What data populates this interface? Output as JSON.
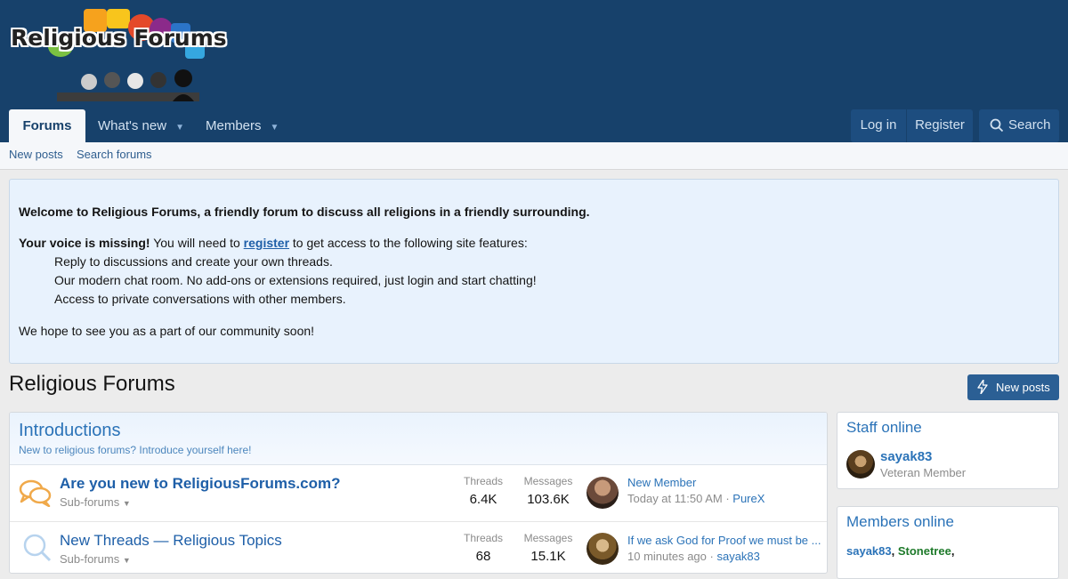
{
  "logo": {
    "text": "Religious Forums"
  },
  "nav": {
    "tabs": [
      {
        "label": "Forums"
      },
      {
        "label": "What's new"
      },
      {
        "label": "Members"
      }
    ],
    "login": "Log in",
    "register": "Register",
    "search": "Search"
  },
  "subnav": {
    "new_posts": "New posts",
    "search_forums": "Search forums"
  },
  "notice": {
    "welcome": "Welcome to Religious Forums, a friendly forum to discuss all religions in a friendly surrounding.",
    "missing_bold": "Your voice is missing!",
    "missing_pre": " You will need to ",
    "register_link": "register",
    "missing_post": " to get access to the following site features:",
    "features": [
      "Reply to discussions and create your own threads.",
      "Our modern chat room. No add-ons or extensions required, just login and start chatting!",
      "Access to private conversations with other members."
    ],
    "closing": "We hope to see you as a part of our community soon!"
  },
  "page": {
    "title": "Religious Forums",
    "new_posts_button": "New posts"
  },
  "category": {
    "title": "Introductions",
    "description": "New to religious forums? Introduce yourself here!",
    "nodes": [
      {
        "title": "Are you new to ReligiousForums.com?",
        "subforums": "Sub-forums",
        "threads_label": "Threads",
        "threads": "6.4K",
        "messages_label": "Messages",
        "messages": "103.6K",
        "latest_title": "New Member",
        "latest_time": "Today at 11:50 AM",
        "latest_sep": " · ",
        "latest_user": "PureX"
      },
      {
        "title": "New Threads — Religious Topics",
        "subforums": "Sub-forums",
        "threads_label": "Threads",
        "threads": "68",
        "messages_label": "Messages",
        "messages": "15.1K",
        "latest_title": "If we ask God for Proof we must be ...",
        "latest_time": "10 minutes ago",
        "latest_sep": " · ",
        "latest_user": "sayak83"
      }
    ]
  },
  "sidebar": {
    "staff_online": {
      "title": "Staff online",
      "name": "sayak83",
      "role": "Veteran Member"
    },
    "members_online": {
      "title": "Members online",
      "member1": "sayak83",
      "member2": "Stonetree",
      "sep1": ", ",
      "sep2": ","
    }
  },
  "colors": {
    "header": "#17416b",
    "accent": "#2b73b8",
    "button": "#2b5f94",
    "notice_bg": "#e8f2fd"
  }
}
